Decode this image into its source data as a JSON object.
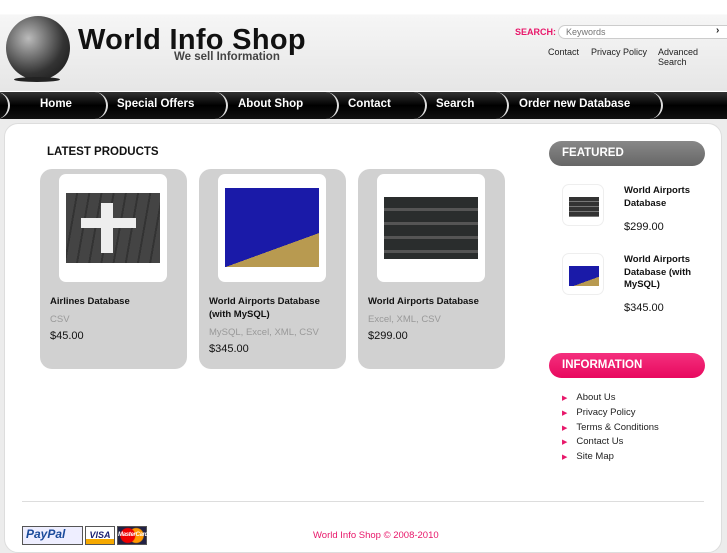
{
  "header": {
    "logo_title": "World Info Shop",
    "tagline": "We sell Information",
    "search_label": "SEARCH:",
    "search_placeholder": "Keywords",
    "search_go": "›",
    "links": [
      "Contact",
      "Privacy Policy",
      "Advanced Search"
    ]
  },
  "nav": [
    "Home",
    "Special Offers",
    "About Shop",
    "Contact",
    "Search",
    "Order new Database"
  ],
  "latest": {
    "title": "LATEST PRODUCTS",
    "products": [
      {
        "name": "Airlines Database",
        "formats": "CSV",
        "price": "$45.00"
      },
      {
        "name": "World Airports Database (with MySQL)",
        "formats": "MySQL, Excel, XML, CSV",
        "price": "$345.00"
      },
      {
        "name": "World Airports Database",
        "formats": "Excel, XML, CSV",
        "price": "$299.00"
      }
    ]
  },
  "featured": {
    "title": "FEATURED",
    "items": [
      {
        "name": "World Airports Database",
        "price": "$299.00"
      },
      {
        "name": "World Airports Database (with MySQL)",
        "price": "$345.00"
      }
    ]
  },
  "information": {
    "title": "INFORMATION",
    "links": [
      "About Us",
      "Privacy Policy",
      "Terms & Conditions",
      "Contact Us",
      "Site Map"
    ]
  },
  "footer": {
    "copyright": "World Info Shop © 2008-2010",
    "payments": [
      "PayPal",
      "VISA",
      "MasterCard"
    ]
  },
  "colors": {
    "accent": "#e8176a"
  }
}
